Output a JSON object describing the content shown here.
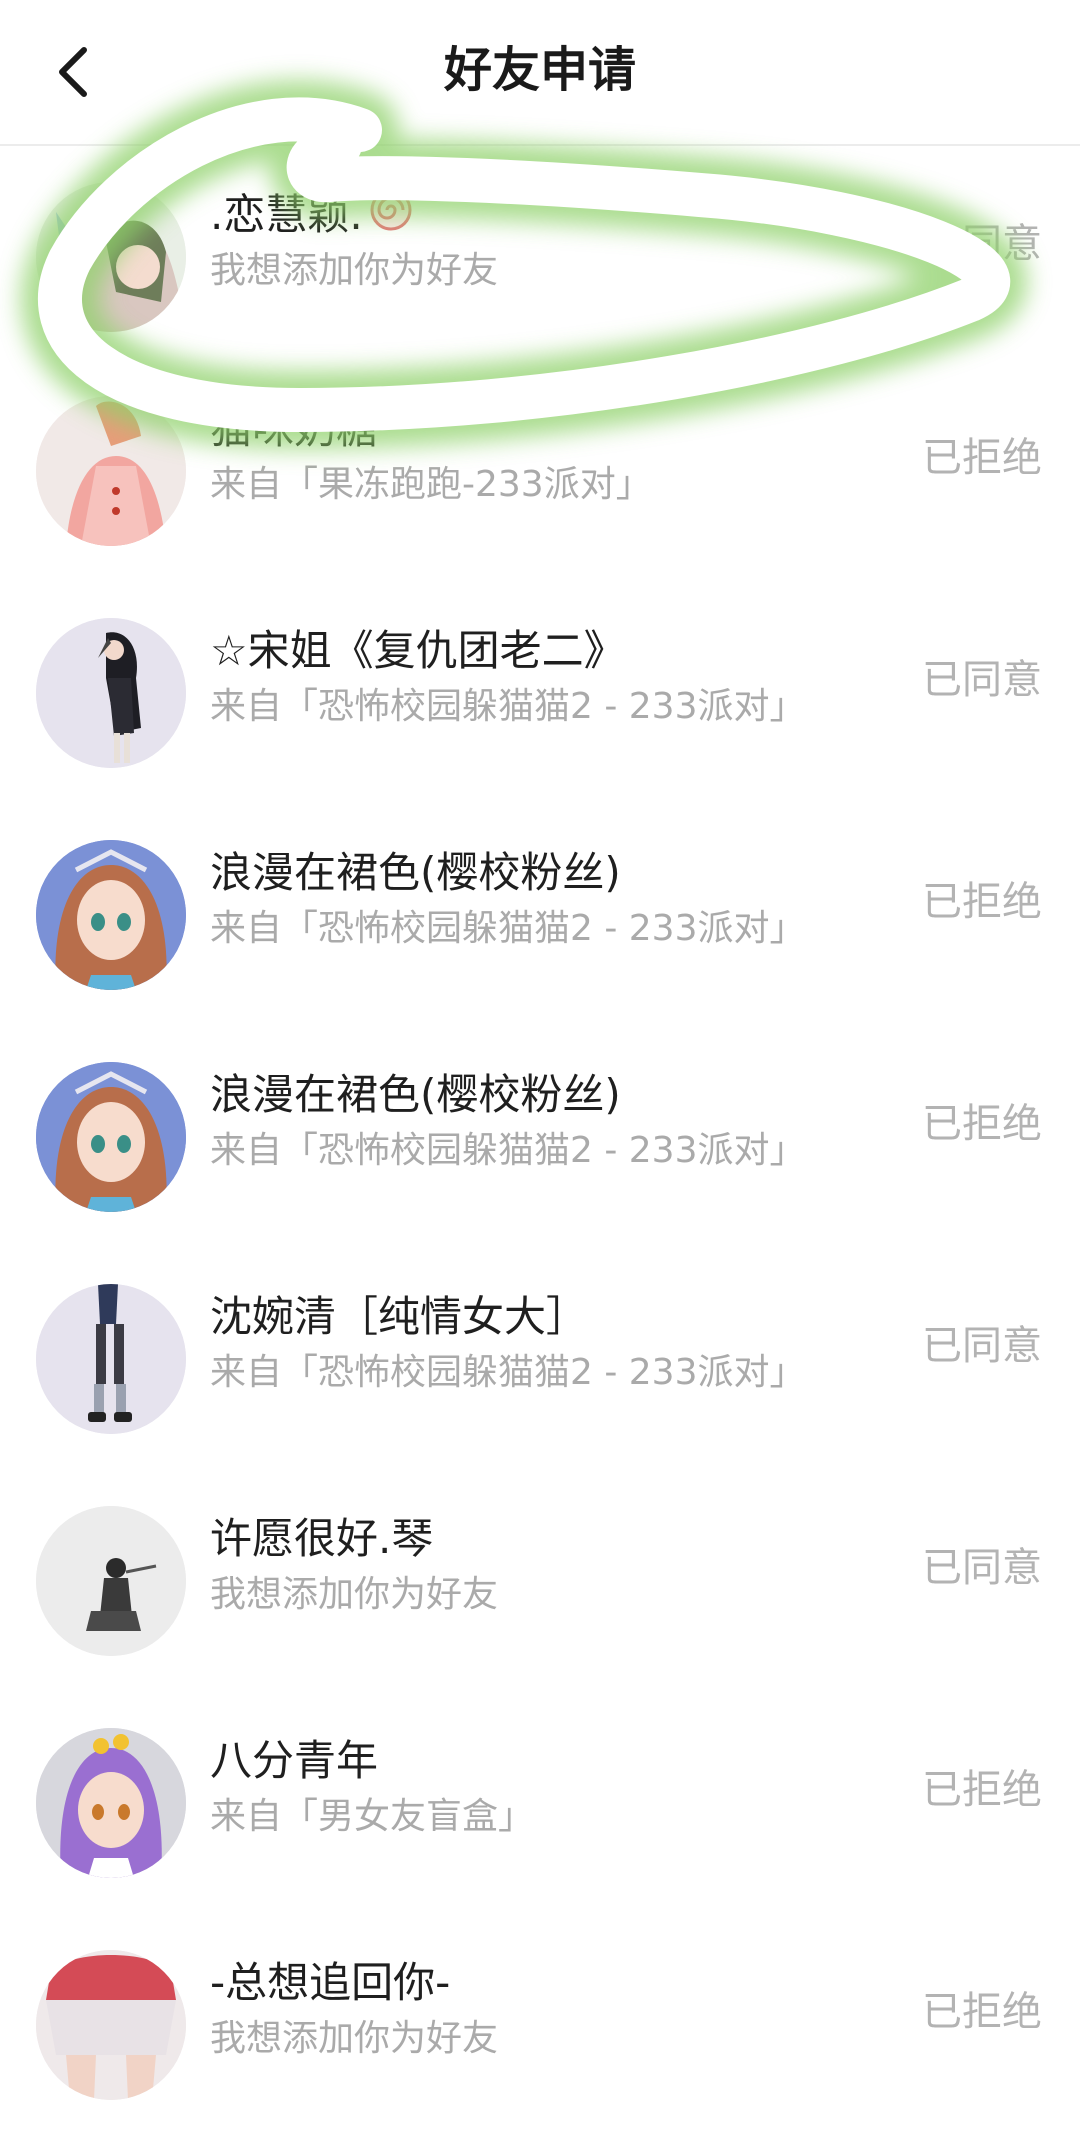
{
  "header": {
    "title": "好友申请"
  },
  "requests": [
    {
      "name": ".恋慧颖.",
      "sub": "我想添加你为好友",
      "status": "已同意",
      "avatar": "avatar-anime-girl-green",
      "has_lollipop_icon": true
    },
    {
      "name": "猫咪奶糖",
      "sub": "来自「果冻跑跑-233派对」",
      "status": "已拒绝",
      "avatar": "avatar-anime-girl-pink"
    },
    {
      "name": "☆宋姐《复仇团老二》",
      "sub": "来自「恐怖校园躲猫猫2 - 233派对」",
      "status": "已同意",
      "avatar": "avatar-dark-figure"
    },
    {
      "name": "浪漫在裙色(樱校粉丝)",
      "sub": "来自「恐怖校园躲猫猫2 - 233派对」",
      "status": "已拒绝",
      "avatar": "avatar-anime-girl-brown-hair"
    },
    {
      "name": "浪漫在裙色(樱校粉丝)",
      "sub": "来自「恐怖校园躲猫猫2 - 233派对」",
      "status": "已拒绝",
      "avatar": "avatar-anime-girl-brown-hair"
    },
    {
      "name": "沈婉清［纯情女大］",
      "sub": "来自「恐怖校园躲猫猫2 - 233派对」",
      "status": "已同意",
      "avatar": "avatar-legs-figure"
    },
    {
      "name": "许愿很好.琴",
      "sub": "我想添加你为好友",
      "status": "已同意",
      "avatar": "avatar-seated-figure"
    },
    {
      "name": "八分青年",
      "sub": "来自「男女友盲盒」",
      "status": "已拒绝",
      "avatar": "avatar-anime-girl-purple-hair"
    },
    {
      "name": "-总想追回你-",
      "sub": "我想添加你为好友",
      "status": "已拒绝",
      "avatar": "avatar-skirt-figure"
    }
  ],
  "colors": {
    "title": "#1a1a1a",
    "name": "#1f1f1f",
    "sub": "#aaaaaa",
    "status": "#b3b3b3",
    "highlight": "#8fd16a"
  }
}
